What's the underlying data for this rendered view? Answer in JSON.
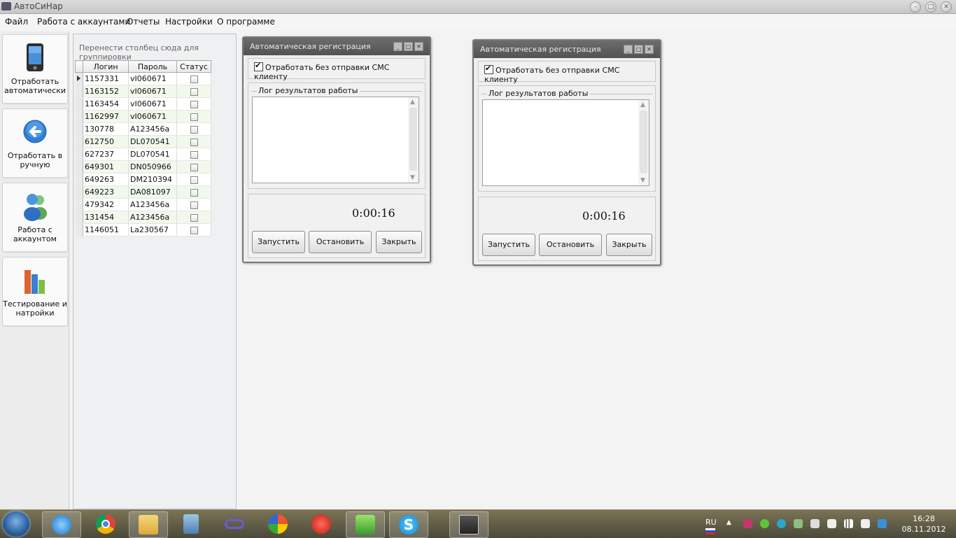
{
  "window": {
    "title": "АвтоСиНар"
  },
  "menu": [
    "Файл",
    "Работа с аккаунтами",
    "Отчеты",
    "Настройки",
    "О программе"
  ],
  "toolbar": [
    {
      "label": "Отработать автоматически",
      "icon": "pda-device-icon"
    },
    {
      "label": "Отработать в ручную",
      "icon": "back-arrow-icon"
    },
    {
      "label": "Работа с аккаунтом",
      "icon": "users-icon"
    },
    {
      "label": "Тестирование и натройки",
      "icon": "bar-chart-icon"
    }
  ],
  "grid": {
    "group_hint": "Перенести столбец сюда для группировки",
    "columns": [
      "Логин",
      "Пароль",
      "Статус"
    ],
    "rows": [
      {
        "login": "1157331",
        "password": "vI060671",
        "status": false
      },
      {
        "login": "1163152",
        "password": "vI060671",
        "status": false
      },
      {
        "login": "1163454",
        "password": "vI060671",
        "status": false
      },
      {
        "login": "1162997",
        "password": "vI060671",
        "status": false
      },
      {
        "login": "130778",
        "password": "A123456a",
        "status": false
      },
      {
        "login": "612750",
        "password": "DL070541",
        "status": false
      },
      {
        "login": "627237",
        "password": "DL070541",
        "status": false
      },
      {
        "login": "649301",
        "password": "DN050966",
        "status": false
      },
      {
        "login": "649263",
        "password": "DM210394",
        "status": false
      },
      {
        "login": "649223",
        "password": "DA081097",
        "status": false
      },
      {
        "login": "479342",
        "password": "A123456a",
        "status": false
      },
      {
        "login": "131454",
        "password": "A123456a",
        "status": false
      },
      {
        "login": "1146051",
        "password": "La230567",
        "status": false
      }
    ]
  },
  "dialogs": [
    {
      "title": "Автоматическая регистрация",
      "checkbox_label": "Отработать без отправки СМС клиенту",
      "checked": true,
      "log_legend": "Лог результатов работы",
      "timer": "0:00:16",
      "buttons": [
        "Запустить",
        "Остановить",
        "Закрыть"
      ]
    },
    {
      "title": "Автоматическая регистрация",
      "checkbox_label": "Отработать без отправки СМС клиенту",
      "checked": true,
      "log_legend": "Лог результатов работы",
      "timer": "0:00:16",
      "buttons": [
        "Запустить",
        "Остановить",
        "Закрыть"
      ]
    }
  ],
  "taskbar": {
    "apps": [
      "internet-explorer-icon",
      "chrome-icon",
      "file-explorer-icon",
      "calculator-icon",
      "infinity-app-icon",
      "colorful-app-icon",
      "red-app-icon",
      "green-app-icon",
      "skype-icon",
      "remote-desktop-icon"
    ],
    "language": "RU",
    "time": "16:28",
    "date": "08.11.2012"
  }
}
